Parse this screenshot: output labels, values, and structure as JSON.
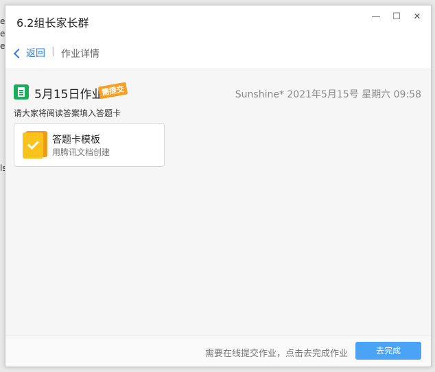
{
  "background": {
    "left_text": [
      "ey",
      "e",
      "e",
      "ls"
    ]
  },
  "window": {
    "title": "6.2组长家长群",
    "controls": {
      "minimize": "—",
      "maximize": "☐",
      "close": "✕"
    }
  },
  "nav": {
    "back_label": "返回",
    "separator": "|",
    "crumb": "作业详情"
  },
  "homework": {
    "icon": "document-icon",
    "title": "5月15日作业",
    "badge": "需提交",
    "meta": "Sunshine* 2021年5月15号 星期六 09:58",
    "description": "请大家将阅读答案填入答题卡",
    "attachment": {
      "icon": "form-template-icon",
      "title": "答题卡模板",
      "subtitle": "用腾讯文档创建"
    }
  },
  "footer": {
    "hint": "需要在线提交作业，点击去完成作业",
    "button": "去完成"
  },
  "colors": {
    "accent": "#2d7be5",
    "button": "#4aa3f4",
    "badge": "#f4a12c",
    "doc_icon": "#1aad5c"
  }
}
